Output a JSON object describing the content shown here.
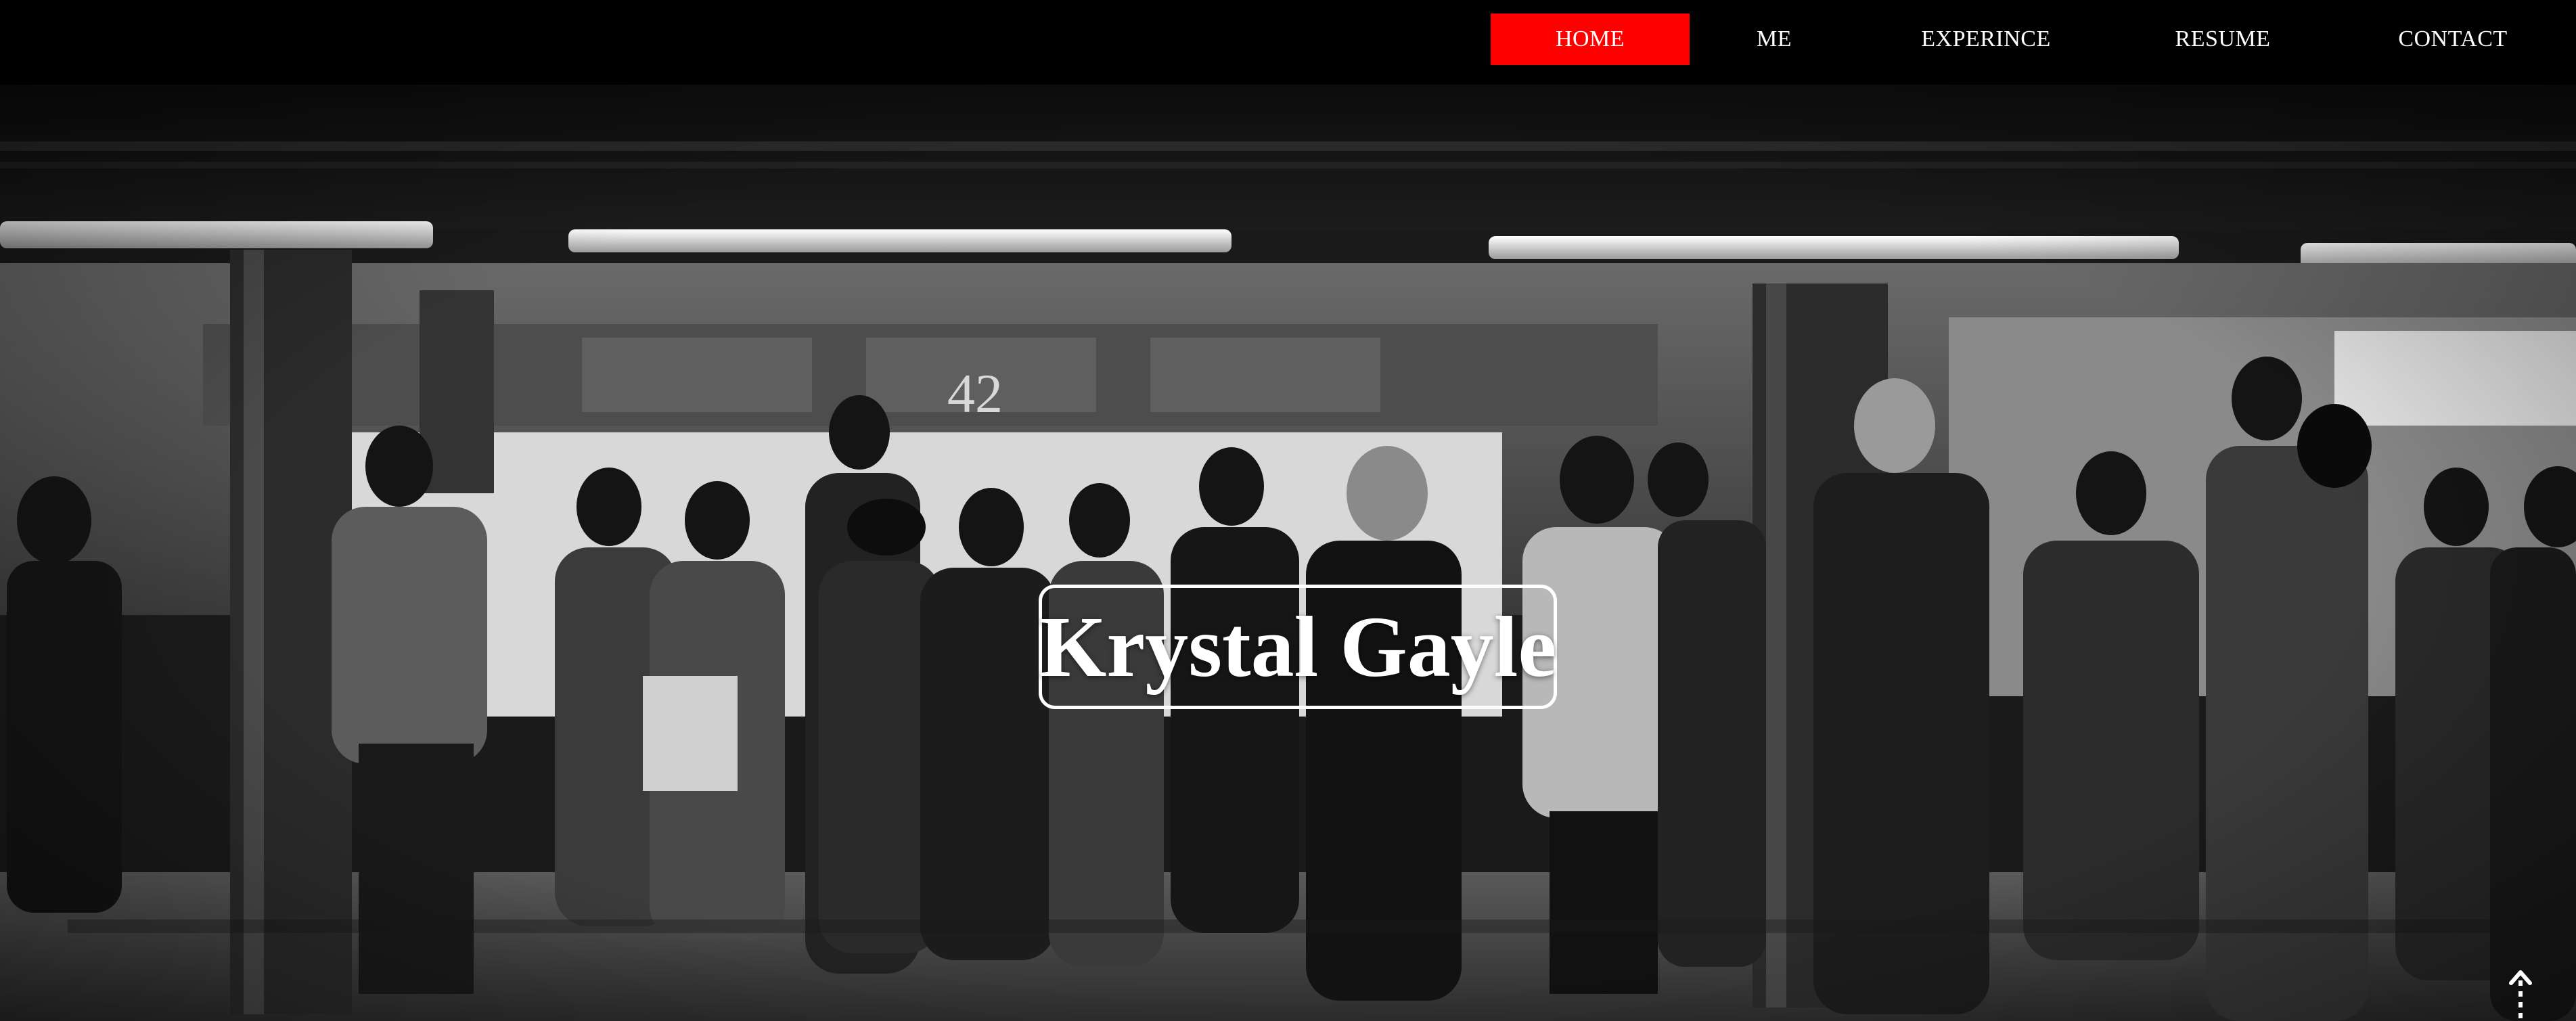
{
  "nav": {
    "items": [
      {
        "label": "HOME",
        "active": true
      },
      {
        "label": "ME",
        "active": false
      },
      {
        "label": "EXPERINCE",
        "active": false
      },
      {
        "label": "RESUME",
        "active": false
      },
      {
        "label": "CONTACT",
        "active": false
      }
    ]
  },
  "hero": {
    "title": "Krystal Gayle",
    "station_number": "42",
    "background_description_icon": "subway-platform-crowd-photo"
  },
  "colors": {
    "nav_background": "#000000",
    "active_nav": "#ff0000",
    "text": "#ffffff"
  },
  "scroll_top": {
    "icon": "arrow-up-icon"
  }
}
